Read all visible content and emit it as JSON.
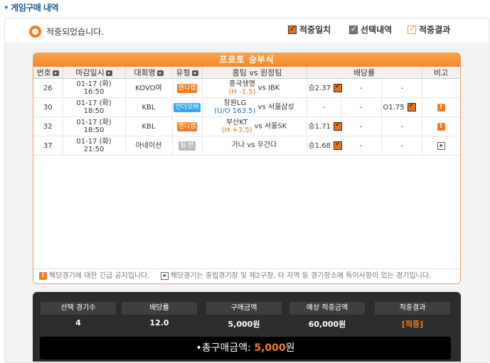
{
  "page": {
    "title": "게임구매 내역",
    "status_text": "적중되었습니다."
  },
  "legend": {
    "match": "적중일치",
    "selection": "선택내역",
    "result": "적중결과"
  },
  "colors": {
    "accent": "#f47c20",
    "header_orange": "#f08a2a",
    "uo_blue": "#37a8e8",
    "summary_bg": "#2c2c2c"
  },
  "proto": {
    "title": "프로토 승부식",
    "columns": {
      "no": "번호",
      "deadline": "마감일시",
      "league": "대회명",
      "type": "유형",
      "teams": "홈팀 vs 원정팀",
      "odds": "배당률",
      "note": "비고"
    },
    "rows": [
      {
        "no": "26",
        "date": "01-17 (화)",
        "time": "16:50",
        "league": "KOVO여",
        "type": "핸디캡",
        "type_kind": "hc",
        "home": "흥국생명",
        "sub": "(H -1.5)",
        "vs": "vs IBK",
        "odd1": "승2.37",
        "odd1_checked": true,
        "odd2": "-",
        "odd3": "-",
        "odd3_checked": false,
        "note": ""
      },
      {
        "no": "30",
        "date": "01-17 (화)",
        "time": "18:50",
        "league": "KBL",
        "type": "언더오버",
        "type_kind": "uo",
        "home": "창원LG",
        "sub": "(U/O 163.5)",
        "vs": "vs 서울삼성",
        "odd1": "-",
        "odd1_checked": false,
        "odd2": "-",
        "odd3": "O1.75",
        "odd3_checked": true,
        "note": "!"
      },
      {
        "no": "32",
        "date": "01-17 (화)",
        "time": "18:50",
        "league": "KBL",
        "type": "핸디캡",
        "type_kind": "hc",
        "home": "부산KT",
        "sub": "(H +3.5)",
        "vs": "vs 서울SK",
        "odd1": "승1.71",
        "odd1_checked": true,
        "odd2": "-",
        "odd3": "-",
        "odd3_checked": false,
        "note": "!"
      },
      {
        "no": "37",
        "date": "01-17 (화)",
        "time": "21:50",
        "league": "아네이션",
        "type": "일 반",
        "type_kind": "gen",
        "home": "가나",
        "sub": "",
        "vs": "vs 우간다",
        "odd1": "승1.68",
        "odd1_checked": true,
        "odd2": "-",
        "odd3": "-",
        "odd3_checked": false,
        "note": "*"
      }
    ],
    "notice_warn": "해당경기에 대한 긴급 공지입니다.",
    "notice_star": "해당경기는 중립경기장 및 제2구장, 타 지역 등 경기장소에 특이사항이 있는 경기입니다."
  },
  "summary": {
    "headers": [
      "선택 경기수",
      "배당률",
      "구매금액",
      "예상 적중금액",
      "적중결과"
    ],
    "values": [
      "4",
      "12.0",
      "5,000원",
      "60,000원",
      "[적중]"
    ],
    "total_label": "총구매금액:",
    "total_amount": "5,000",
    "total_unit": "원"
  }
}
